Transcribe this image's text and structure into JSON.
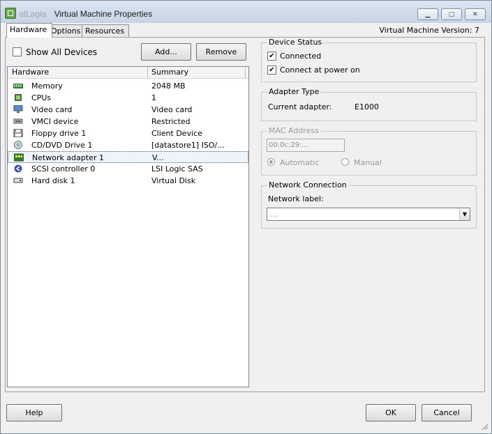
{
  "window": {
    "title_prefix": "atLagla",
    "title": "Virtual Machine Properties",
    "controls": [
      "minimize",
      "maximize",
      "close"
    ]
  },
  "tabs": [
    {
      "label": "Hardware",
      "active": true
    },
    {
      "label": "Options",
      "active": false
    },
    {
      "label": "Resources",
      "active": false
    }
  ],
  "vm_version": "Virtual Machine Version: 7",
  "toolbar": {
    "show_all_label": "Show All Devices",
    "show_all_checked": false,
    "add_label": "Add...",
    "remove_label": "Remove"
  },
  "hardware_table": {
    "columns": [
      "Hardware",
      "Summary"
    ],
    "rows": [
      {
        "name": "Memory",
        "summary": "2048 MB",
        "icon": "memory-icon"
      },
      {
        "name": "CPUs",
        "summary": "1",
        "icon": "cpu-icon"
      },
      {
        "name": "Video card",
        "summary": "Video card",
        "icon": "monitor-icon"
      },
      {
        "name": "VMCI device",
        "summary": "Restricted",
        "icon": "vmci-icon"
      },
      {
        "name": "Floppy drive 1",
        "summary": "Client Device",
        "icon": "floppy-icon"
      },
      {
        "name": "CD/DVD Drive 1",
        "summary": "[datastore1] ISO/...",
        "icon": "cd-icon"
      },
      {
        "name": "Network adapter 1",
        "summary": "V...",
        "icon": "network-icon",
        "selected": true
      },
      {
        "name": "SCSI controller 0",
        "summary": "LSI Logic SAS",
        "icon": "scsi-icon"
      },
      {
        "name": "Hard disk 1",
        "summary": "Virtual Disk",
        "icon": "disk-icon"
      }
    ]
  },
  "device_status": {
    "title": "Device Status",
    "connected_label": "Connected",
    "connected_checked": true,
    "power_on_label": "Connect at power on",
    "power_on_checked": true
  },
  "adapter_type": {
    "title": "Adapter Type",
    "current_label": "Current adapter:",
    "current_value": "E1000"
  },
  "mac_address": {
    "title": "MAC Address",
    "value": "00:0c:29:...",
    "automatic_label": "Automatic",
    "manual_label": "Manual",
    "selected": "automatic"
  },
  "network_connection": {
    "title": "Network Connection",
    "label": "Network label:",
    "value": "..."
  },
  "footer": {
    "help_label": "Help",
    "ok_label": "OK",
    "cancel_label": "Cancel"
  },
  "colors": {
    "titlebar_top": "#dce6f2",
    "titlebar_bottom": "#c7d4e5",
    "window_bg": "#f0f0f0",
    "selection_bg": "#eef4fb"
  }
}
